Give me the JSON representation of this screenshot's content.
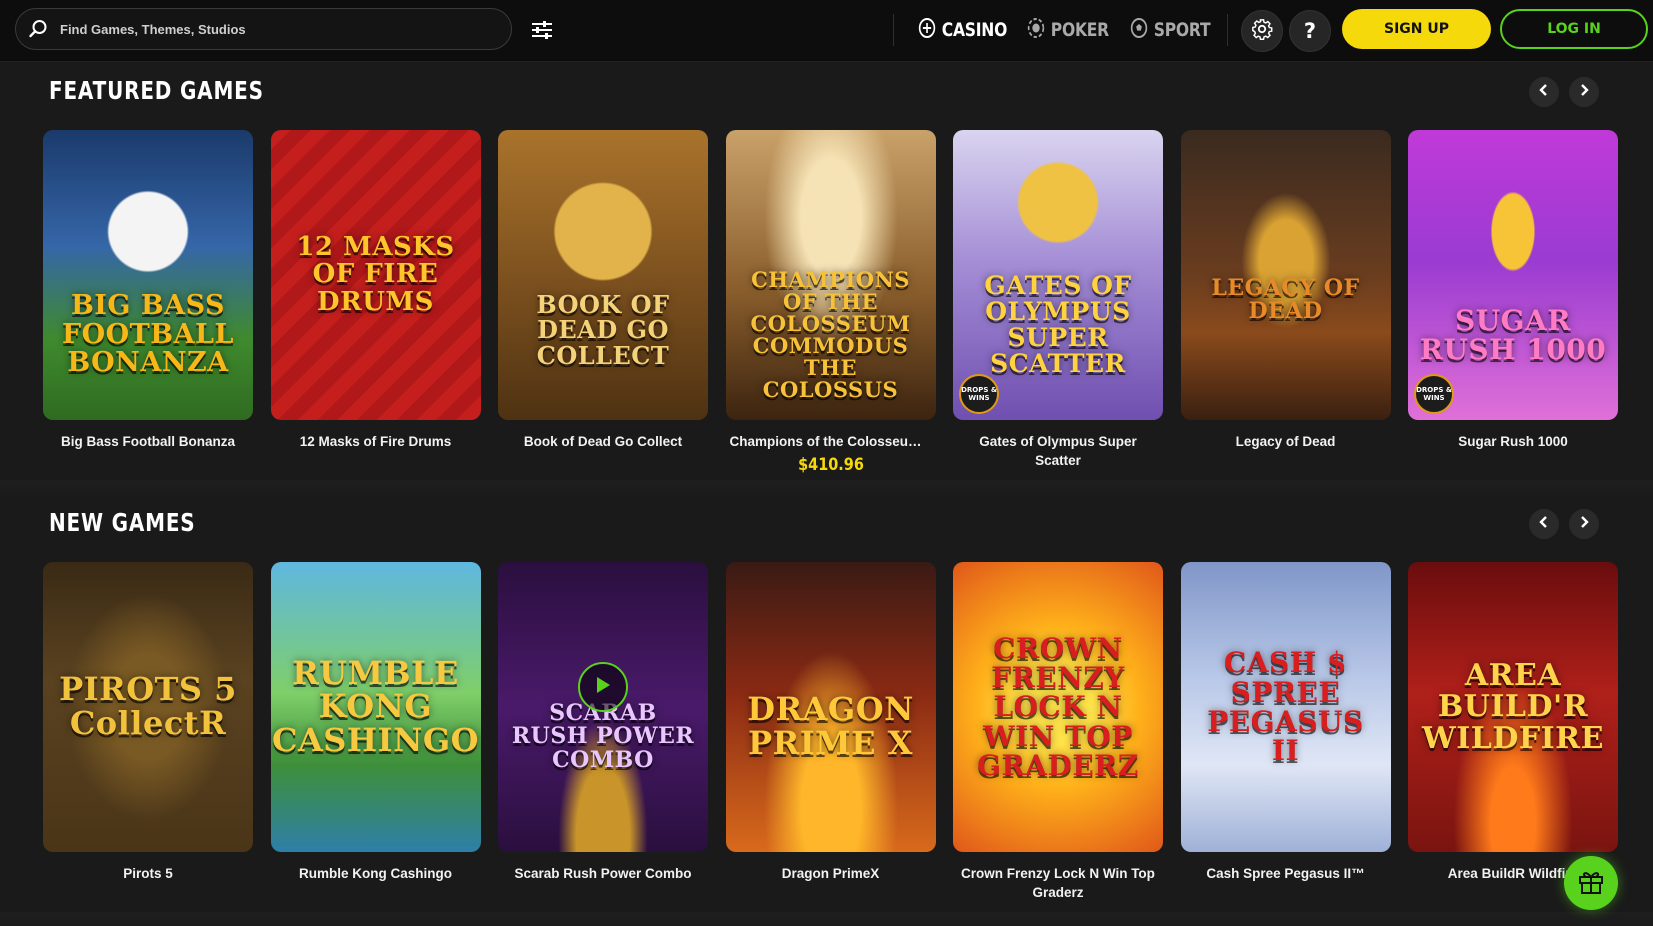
{
  "header": {
    "search_placeholder": "Find Games, Themes, Studios",
    "nav": [
      {
        "label": "CASINO",
        "icon": "casino-chip-icon",
        "active": true
      },
      {
        "label": "POKER",
        "icon": "poker-chip-icon",
        "active": false
      },
      {
        "label": "SPORT",
        "icon": "soccer-ball-icon",
        "active": false
      }
    ],
    "help_label": "?",
    "signup_label": "SIGN UP",
    "login_label": "LOG IN",
    "colors": {
      "accent_yellow": "#f5d90a",
      "accent_green": "#58d21c"
    }
  },
  "featured": {
    "title": "FEATURED GAMES",
    "games": [
      {
        "name": "Big Bass Football Bonanza",
        "art": "BIG BASS FOOTBALL BONANZA"
      },
      {
        "name": "12 Masks of Fire Drums",
        "art": "12 MASKS OF FIRE DRUMS"
      },
      {
        "name": "Book of Dead Go Collect",
        "art": "BOOK OF DEAD GO COLLECT"
      },
      {
        "name": "Champions of the Colosseum: Com…",
        "art": "CHAMPIONS OF THE COLOSSEUM COMMODUS THE COLOSSUS",
        "jackpot": "$410.96"
      },
      {
        "name": "Gates of Olympus Super Scatter",
        "art": "GATES OF OLYMPUS SUPER SCATTER",
        "badge": "DROPS & WINS"
      },
      {
        "name": "Legacy of Dead",
        "art": "LEGACY OF DEAD"
      },
      {
        "name": "Sugar Rush 1000",
        "art": "SUGAR RUSH 1000",
        "badge": "DROPS & WINS"
      }
    ]
  },
  "new_games": {
    "title": "NEW GAMES",
    "games": [
      {
        "name": "Pirots 5",
        "art": "PIROTS 5 CollectR"
      },
      {
        "name": "Rumble Kong Cashingo",
        "art": "RUMBLE KONG CASHINGO"
      },
      {
        "name": "Scarab Rush Power Combo",
        "art": "SCARAB RUSH POWER COMBO"
      },
      {
        "name": "Dragon PrimeX",
        "art": "DRAGON PRIME X"
      },
      {
        "name": "Crown Frenzy Lock N Win Top Graderz",
        "art": "CROWN FRENZY LOCK N WIN TOP GRADERZ"
      },
      {
        "name": "Cash Spree Pegasus II™",
        "art": "CASH $ SPREE PEGASUS II"
      },
      {
        "name": "Area BuildR Wildfire",
        "art": "AREA BUILD'R WILDFIRE"
      }
    ]
  }
}
